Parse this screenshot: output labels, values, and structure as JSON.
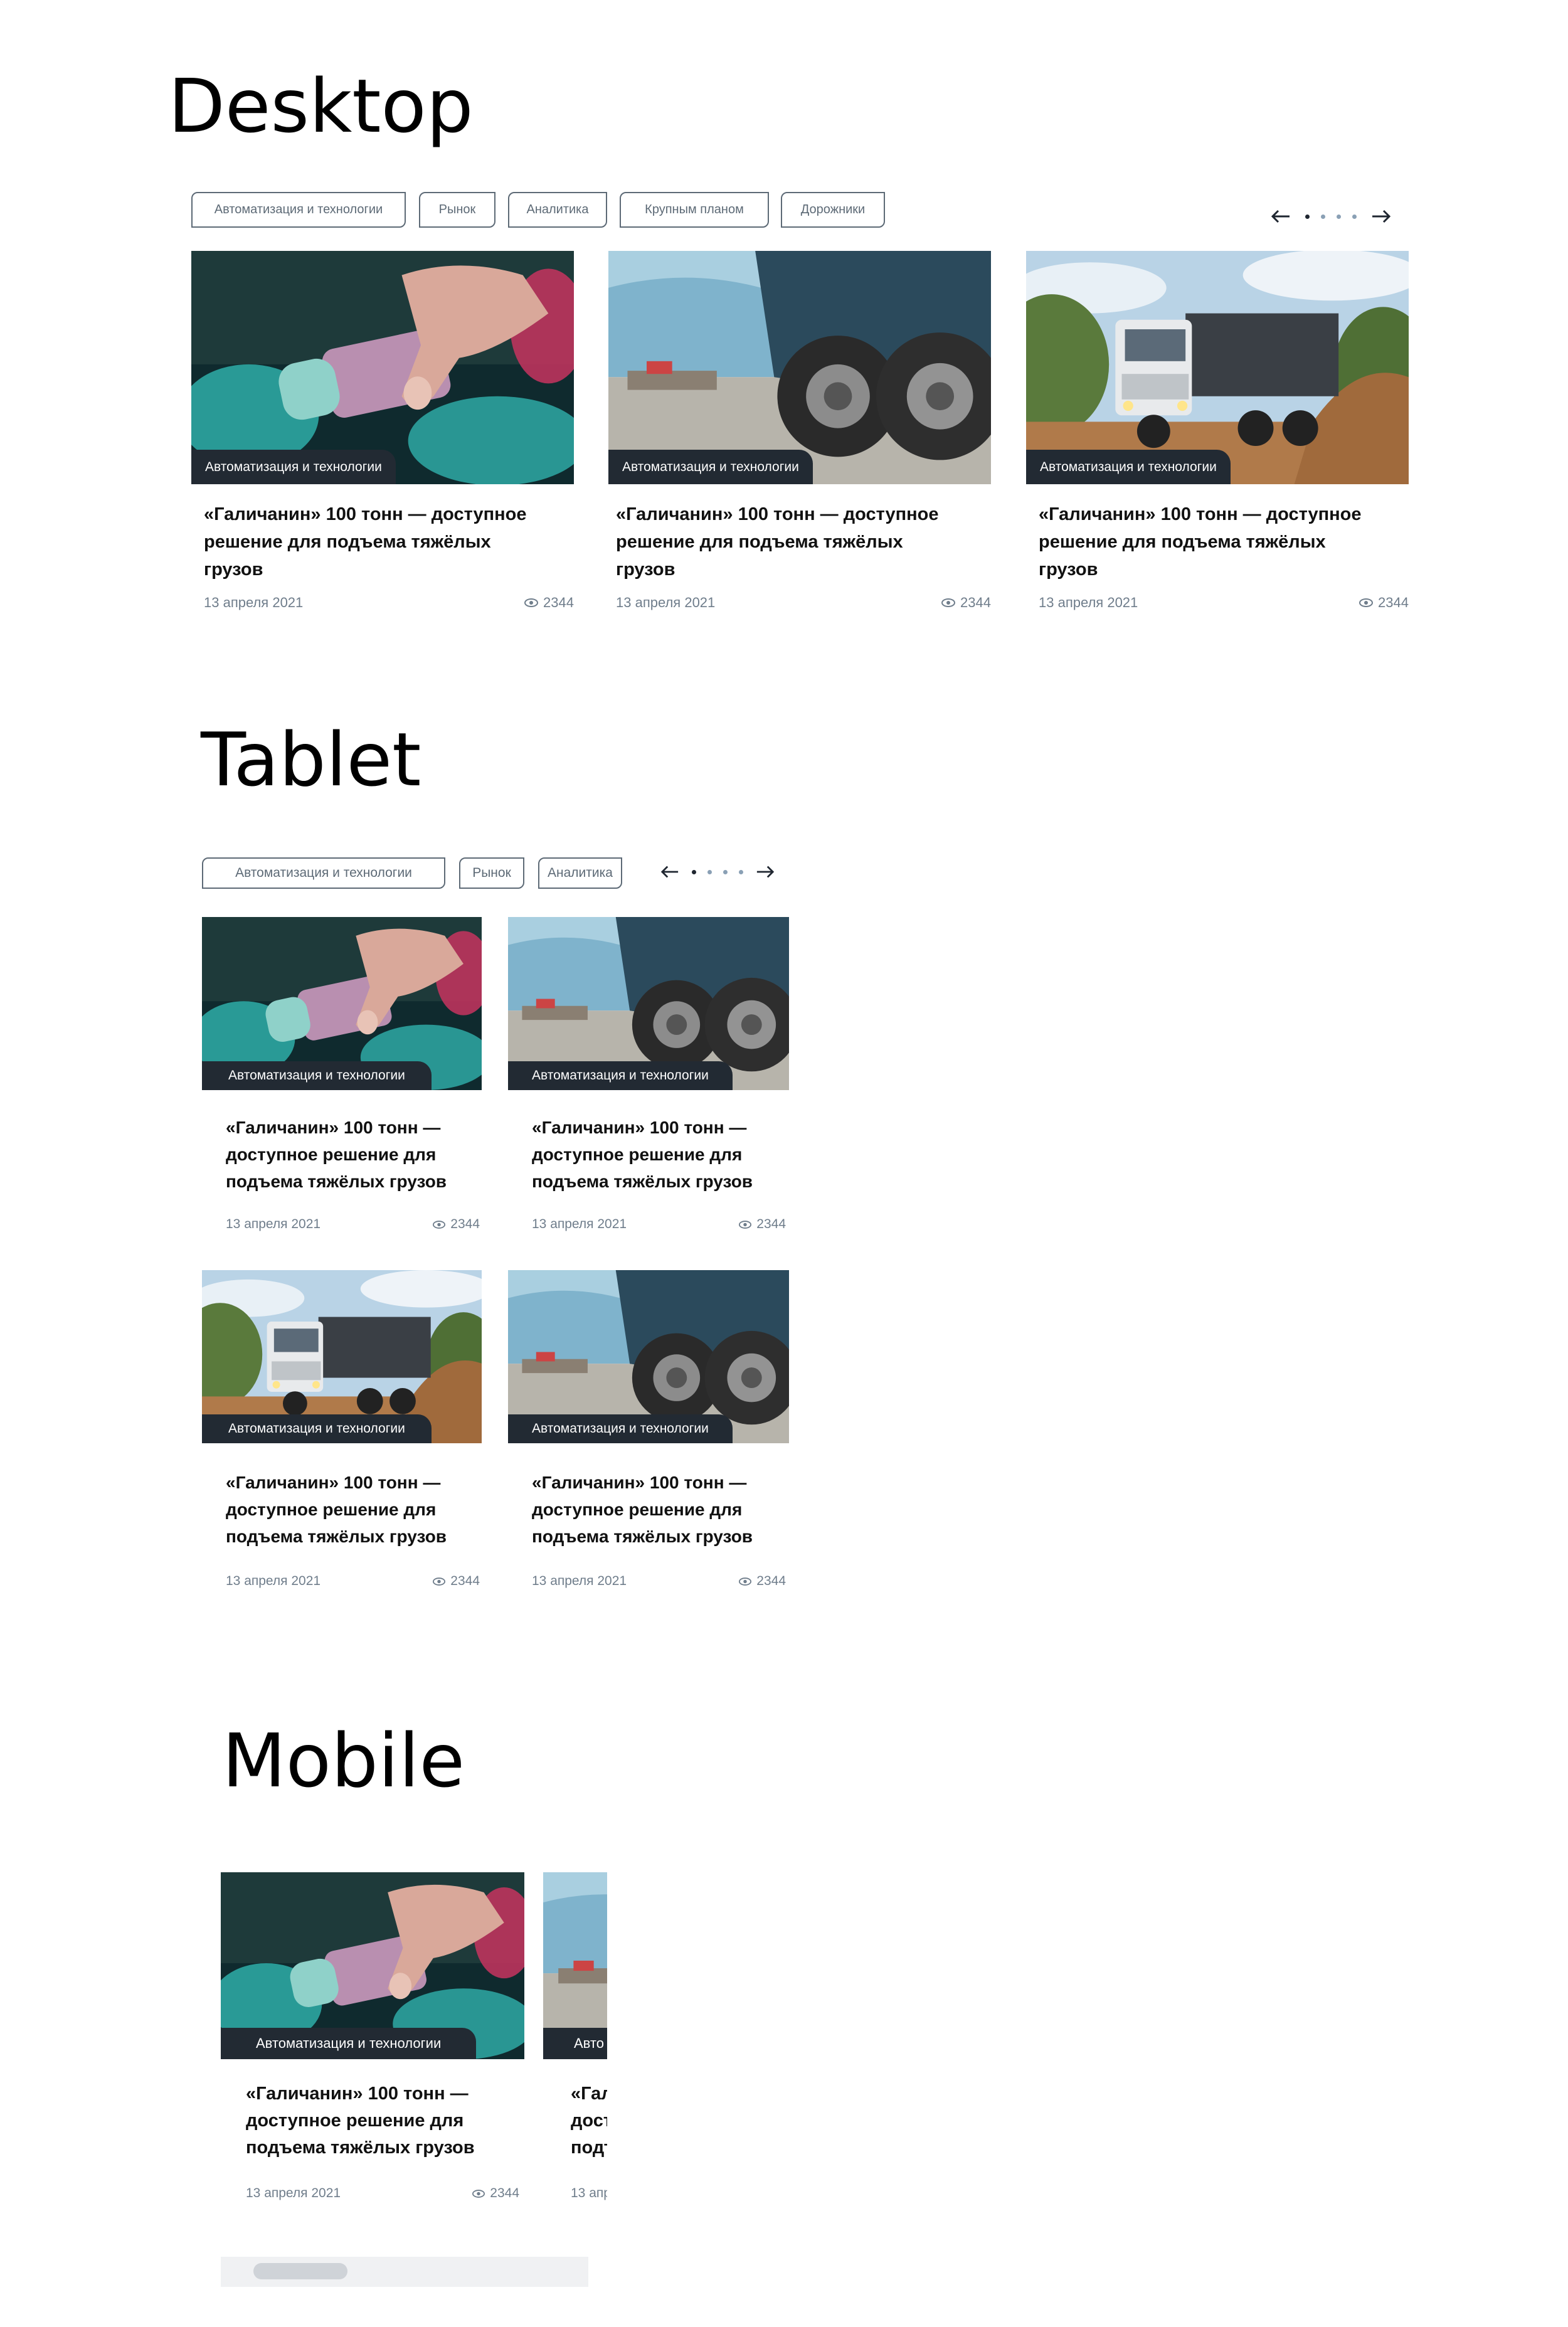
{
  "sections": {
    "desktop": "Desktop",
    "tablet": "Tablet",
    "mobile": "Mobile"
  },
  "tags": [
    "Автоматизация и технологии",
    "Рынок",
    "Аналитика",
    "Крупным планом",
    "Дорожники"
  ],
  "card": {
    "category": "Автоматизация и технологии",
    "title": "«Галичанин» 100 тонн — доступное решение для подъема тяжёлых грузов",
    "title_lines_desktop": [
      "«Галичанин» 100 тонн — доступное",
      "решение для подъема тяжёлых",
      "грузов"
    ],
    "title_lines_narrow": [
      "«Галичанин» 100 тонн —",
      "доступное решение для",
      "подъема тяжёлых грузов"
    ],
    "date": "13 апреля 2021",
    "views": "2344"
  },
  "mobile_peek": {
    "category": "Авто",
    "title_lines": [
      "«Гал",
      "дост",
      "подъ"
    ],
    "date": "13 апр"
  },
  "pager": {
    "dots": 4,
    "active": 0
  },
  "icons": [
    "arrow-left-icon",
    "arrow-right-icon",
    "eye-icon"
  ],
  "colors": {
    "badge": "#222a33",
    "tag_border": "#5d6a76",
    "meta": "#6f7d8b"
  }
}
